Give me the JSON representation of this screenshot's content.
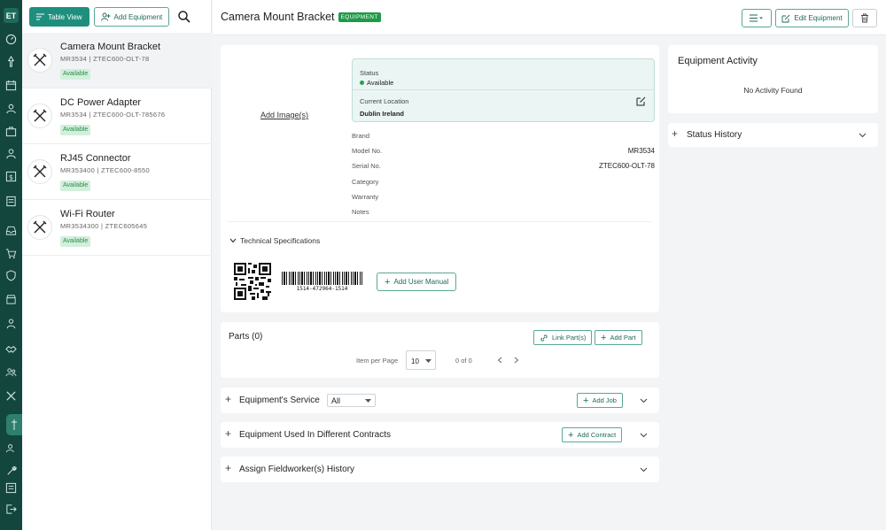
{
  "nav": {
    "logo": "ET"
  },
  "list": {
    "table_view_label": "Table View",
    "add_equipment_label": "Add Equipment",
    "items": [
      {
        "name": "Camera Mount Bracket",
        "sub": "MR3534  |  ZTEC600-OLT-78",
        "status": "Available"
      },
      {
        "name": "DC Power Adapter",
        "sub": "MR3534  |  ZTEC600-OLT-785676",
        "status": "Available"
      },
      {
        "name": "RJ45 Connector",
        "sub": "MR353400  |  ZTEC600-8550",
        "status": "Available"
      },
      {
        "name": "Wi-Fi Router",
        "sub": "MR3534300  |  ZTEC605645",
        "status": "Available"
      }
    ]
  },
  "header": {
    "title": "Camera Mount Bracket",
    "tag": "EQUIPMENT",
    "edit_label": "Edit Equipment"
  },
  "details": {
    "add_images_label": "Add Image(s)",
    "status_label": "Status",
    "status_value": "Available",
    "location_label": "Current Location",
    "location_value": "Dublin Ireland",
    "fields": [
      {
        "label": "Brand",
        "value": ""
      },
      {
        "label": "Model No.",
        "value": "MR3534"
      },
      {
        "label": "Serial No.",
        "value": "ZTEC600-OLT-78"
      },
      {
        "label": "Category",
        "value": ""
      },
      {
        "label": "Warranty",
        "value": ""
      },
      {
        "label": "Notes",
        "value": ""
      }
    ],
    "tech_spec_label": "Technical Specifications",
    "barcode_text": "1514-472964-1514",
    "add_manual_label": "Add User Manual"
  },
  "parts": {
    "title": "Parts (0)",
    "link_label": "Link Part(s)",
    "add_label": "Add Part",
    "per_page_label": "Item per Page",
    "per_page_value": "10",
    "range": "0 of 0"
  },
  "sections": {
    "service_title": "Equipment's Service",
    "service_filter": "All",
    "add_job_label": "Add Job",
    "contracts_title": "Equipment Used In Different Contracts",
    "add_contract_label": "Add Contract",
    "fieldworker_title": "Assign Fieldworker(s) History"
  },
  "activity": {
    "title": "Equipment Activity",
    "empty": "No Activity Found",
    "status_history_title": "Status History"
  }
}
